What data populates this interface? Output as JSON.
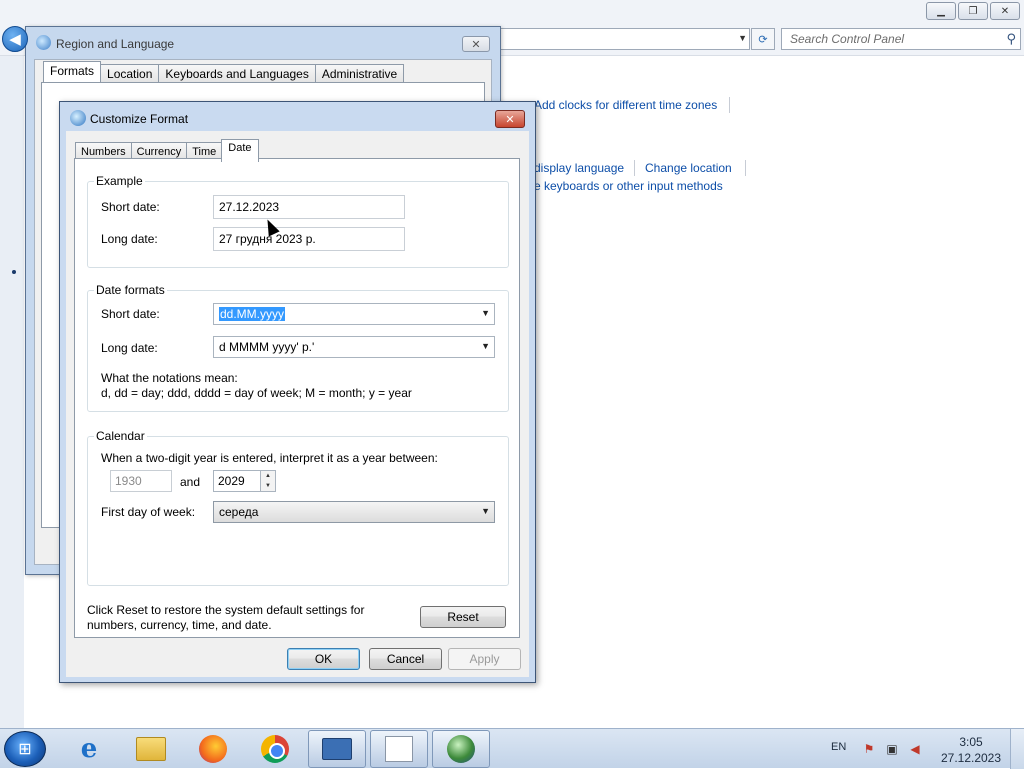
{
  "control_panel": {
    "search_placeholder": "Search Control Panel",
    "links": {
      "add_clocks": "Add clocks for different time zones",
      "display_language": "display language",
      "change_location": "Change location",
      "keyboards": "e keyboards or other input methods"
    },
    "window_buttons": {
      "minimize": "▁",
      "maximize": "❐",
      "close": "✕"
    }
  },
  "region_language": {
    "title": "Region and Language",
    "tabs": [
      "Formats",
      "Location",
      "Keyboards and Languages",
      "Administrative"
    ],
    "active_tab": "Formats"
  },
  "customize_format": {
    "title": "Customize Format",
    "tabs": [
      "Numbers",
      "Currency",
      "Time",
      "Date"
    ],
    "active_tab": "Date",
    "example": {
      "group_title": "Example",
      "short_date_label": "Short date:",
      "short_date_value": "27.12.2023",
      "long_date_label": "Long date:",
      "long_date_value": "27 грудня 2023 р."
    },
    "date_formats": {
      "group_title": "Date formats",
      "short_date_label": "Short date:",
      "short_date_value": "dd.MM.yyyy",
      "long_date_label": "Long date:",
      "long_date_value": "d MMMM yyyy' р.'",
      "notation_title": "What the notations mean:",
      "notation_text": "d, dd = day;  ddd, dddd = day of week;  M = month;  y = year"
    },
    "calendar": {
      "group_title": "Calendar",
      "two_digit_text": "When a two-digit year is entered, interpret it as a year between:",
      "year_from": "1930",
      "and_label": "and",
      "year_to": "2029",
      "first_day_label": "First day of week:",
      "first_day_value": "середа"
    },
    "reset_text": "Click Reset to restore the system default settings for numbers, currency, time, and date.",
    "reset_label": "Reset",
    "ok_label": "OK",
    "cancel_label": "Cancel",
    "apply_label": "Apply"
  },
  "taskbar": {
    "language": "EN",
    "time": "3:05",
    "date": "27.12.2023",
    "items": [
      "start-orb",
      "internet-explorer",
      "windows-explorer",
      "firefox",
      "chrome",
      "control-panel",
      "calendar-app",
      "region-globe"
    ]
  }
}
